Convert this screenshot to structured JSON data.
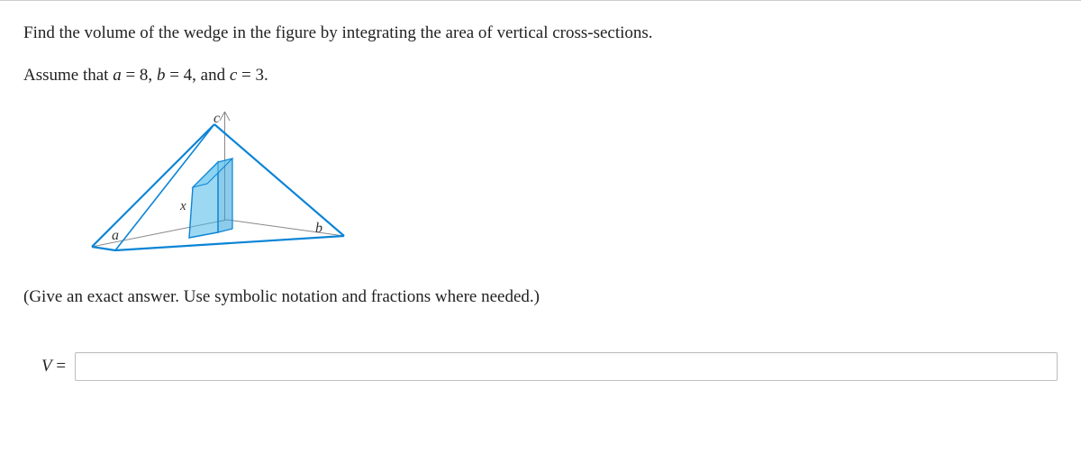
{
  "problem": {
    "line1": "Find the volume of the wedge in the figure by integrating the area of vertical cross-sections.",
    "line2_pre": "Assume that ",
    "a_var": "a",
    "a_eq": " = 8, ",
    "b_var": "b",
    "b_eq": " = 4, and ",
    "c_var": "c",
    "c_eq": " = 3.",
    "instruction": "(Give an exact answer. Use symbolic notation and fractions where needed.)"
  },
  "figure": {
    "label_a": "a",
    "label_b": "b",
    "label_c": "c",
    "label_x": "x"
  },
  "answer": {
    "label_var": "V",
    "label_eq": " =",
    "value": ""
  }
}
